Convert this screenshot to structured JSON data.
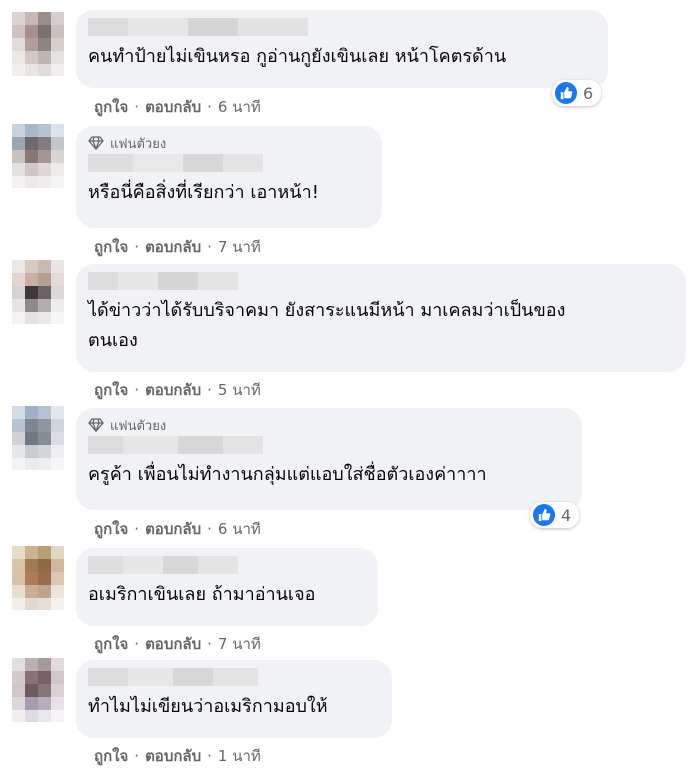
{
  "fan_badge_label": "แฟนตัวยง",
  "actions": {
    "like": "ถูกใจ",
    "reply": "ตอบกลับ",
    "dot": "·"
  },
  "comments": [
    {
      "text_lines": [
        "คนทำป้ายไม่เขินหรอ กูอ่านกูยังเขินเลย หน้าโคตรด้าน"
      ],
      "time": "6 นาที",
      "reactions": "6"
    },
    {
      "text_lines": [
        "หรือนี่คือสิ่งที่เรียกว่า เอาหน้า!"
      ],
      "time": "7 นาที"
    },
    {
      "text_lines": [
        "ได้ข่าวว่าได้รับบริจาคมา ยังสาระแนมีหน้า มาเคลมว่าเป็นของ",
        "ตนเอง"
      ],
      "time": "5 นาที"
    },
    {
      "text_lines": [
        "ครูค้า เพื่อนไม่ทำงานกลุ่มแต่แอบใส่ชื่อตัวเองค่าาาา"
      ],
      "time": "6 นาที",
      "reactions": "4"
    },
    {
      "text_lines": [
        "อเมริกาเขินเลย ถ้ามาอ่านเจอ"
      ],
      "time": "7 นาที"
    },
    {
      "text_lines": [
        "ทำไมไม่เขียนว่าอเมริกามอบให้"
      ],
      "time": "1 นาที"
    }
  ],
  "colors": {
    "bubble": "#f0f2f5",
    "action_text": "#65676b",
    "like_blue": "#1877f2"
  },
  "icons": {
    "badge": "diamond-icon",
    "reaction": "thumbs-up-icon"
  }
}
